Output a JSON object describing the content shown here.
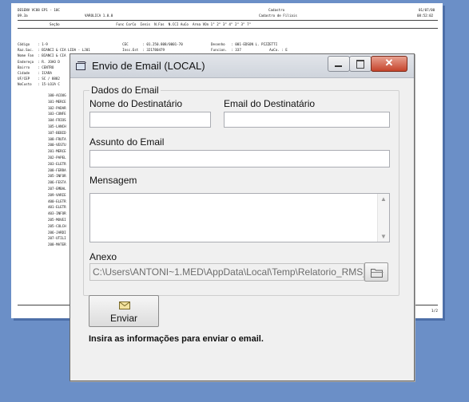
{
  "report": {
    "header_left_1": "DESENV VC88 EP1 - 10C",
    "header_left_2": "09.3a",
    "header_mid": "VAROLICA 1.0.0",
    "header_title_1": "Cadastro",
    "header_title_2": "Cadastro de Filiais",
    "header_date": "01/07/00",
    "header_time": "08:52:02",
    "col_header": "Seção                            Func CorCo  Ienis  N.Fas  N.CCI AuCo  Area VOn 1\" 2\" 3\" 4\" 2\" 3\" 7\"",
    "lines": [
      "Código    : 1-9                                     CEC       : 01.250.808/0001-70              Desenho   : 001-EDSON L. PIZZETTI",
      "Raz.Soc.  : BIANCI & CIA LIDA - LJ01                Insc.Est  : 321780479                       Funcion.  : 337              AuCo. : E",
      "Nome Fan  : BIANCI & CIA",
      "Endereço  : R. JOAO D",
      "Bairro    : CENTRO",
      "Cidade    : ICARA",
      "UF/CEP    : SC / 8882",
      "NoCusto   : 15-LOJA C"
    ],
    "codes": [
      "100-ACOUG",
      "101-MERCE",
      "102-PADAR",
      "103-CONFE",
      "104-FRIOS",
      "105-LANCH",
      "107-BEBID",
      "108-FRUTA",
      "200-VESTU",
      "201-MERCE",
      "202-PAPEL",
      "203-ELETR",
      "208-FERRA",
      "205-INFOR",
      "206-FESTA",
      "207-EMBAL",
      "209-VARIE",
      "400-ELETR",
      "401-ELETR",
      "403-INFOR",
      "205-MOVEI",
      "205-COLCH",
      "206-JARDI",
      "207-UTILI",
      "208-MATER"
    ],
    "page_num": "1/2"
  },
  "window": {
    "title": "Envio de Email (LOCAL)",
    "group_label": "Dados do Email",
    "recipient_name_label": "Nome do Destinatário",
    "recipient_name_value": "",
    "recipient_email_label": "Email do Destinatário",
    "recipient_email_value": "",
    "subject_label": "Assunto do Email",
    "subject_value": "",
    "message_label": "Mensagem",
    "message_value": "",
    "attachment_label": "Anexo",
    "attachment_value": "C:\\Users\\ANTONI~1.MED\\AppData\\Local\\Temp\\Relatorio_RMS_132",
    "send_label": "Enviar",
    "status_text": "Insira as informações para enviar o email."
  }
}
